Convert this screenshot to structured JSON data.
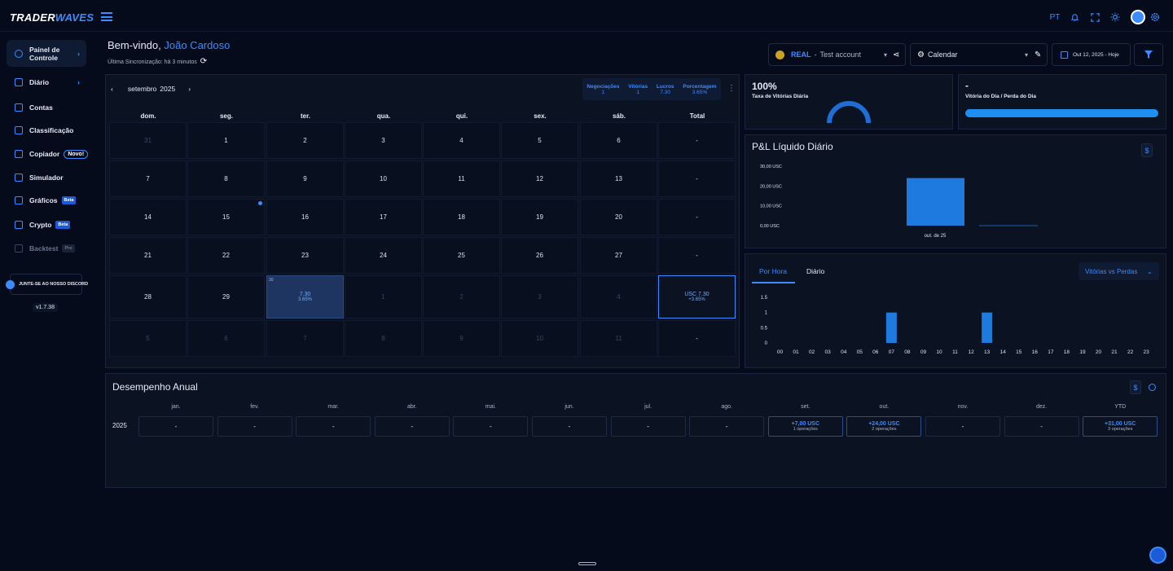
{
  "topbar": {
    "logo_a": "TRADER",
    "logo_b": "WAVES",
    "lang": "PT"
  },
  "sidebar": {
    "items": [
      {
        "label": "Painel de Controle",
        "icon": "dashboard-icon"
      },
      {
        "label": "Diário",
        "icon": "pencil-icon"
      },
      {
        "label": "Contas",
        "icon": "accounts-icon"
      },
      {
        "label": "Classificação",
        "icon": "ranking-icon"
      },
      {
        "label": "Copiador",
        "icon": "copy-icon",
        "badge": "Novo!"
      },
      {
        "label": "Simulador",
        "icon": "simulator-icon"
      },
      {
        "label": "Gráficos",
        "icon": "chart-icon",
        "badge": "Beta"
      },
      {
        "label": "Crypto",
        "icon": "bitcoin-icon",
        "badge": "Beta"
      },
      {
        "label": "Backtest",
        "icon": "rewind-icon",
        "badge": "Pro"
      }
    ],
    "discord": "JUNTE-SE AO NOSSO DISCORD",
    "version": "v1.7.38"
  },
  "header": {
    "welcome": "Bem-vindo,",
    "user": "João Cardoso",
    "sync": "Última Sincronização: há 3 minutos",
    "account_type": "REAL",
    "account_sep": "-",
    "account_name": "Test account",
    "view": "Calendar",
    "date_range": "Out 12, 2025 - Hoje"
  },
  "calendar": {
    "month": "setembro",
    "year": "2025",
    "stats": [
      {
        "label": "Negociações",
        "value": "1"
      },
      {
        "label": "Vitórias",
        "value": "1"
      },
      {
        "label": "Lucros",
        "value": "7.30"
      },
      {
        "label": "Porcentagem",
        "value": "3.65%"
      }
    ],
    "weekdays": [
      "dom.",
      "seg.",
      "ter.",
      "qua.",
      "qui.",
      "sex.",
      "sáb.",
      "Total"
    ],
    "weeks": [
      {
        "days": [
          "31",
          "1",
          "2",
          "3",
          "4",
          "5",
          "6"
        ],
        "total": "-"
      },
      {
        "days": [
          "7",
          "8",
          "9",
          "10",
          "11",
          "12",
          "13"
        ],
        "total": "-"
      },
      {
        "days": [
          "14",
          "15",
          "16",
          "17",
          "18",
          "19",
          "20"
        ],
        "total": "-"
      },
      {
        "days": [
          "21",
          "22",
          "23",
          "24",
          "25",
          "26",
          "27"
        ],
        "total": "-"
      },
      {
        "days": [
          "28",
          "29",
          "30",
          "1",
          "2",
          "3",
          "4"
        ],
        "total": "USC 7.30",
        "total_pct": "+3.65%"
      },
      {
        "days": [
          "5",
          "6",
          "7",
          "8",
          "9",
          "10",
          "11"
        ],
        "total": "-"
      }
    ],
    "selected_day": {
      "label": "30",
      "value": "7.30",
      "pct": "3.65%"
    }
  },
  "kpi": {
    "win_rate": "100%",
    "win_rate_label": "Taxa de Vitórias Diária",
    "win_rate_value": 1.0,
    "win_loss": "-",
    "win_loss_label": "Vitória do Dia / Perda do Dia"
  },
  "pnl": {
    "title": "P&L Líquido Diário",
    "currency_btn": "$"
  },
  "hourly": {
    "tabs": [
      "Por Hora",
      "Diário"
    ],
    "select": "Vitórias vs Perdas"
  },
  "chart_data": [
    {
      "type": "bar",
      "categories": [
        "out. de 25"
      ],
      "values": [
        24
      ],
      "yticks": [
        "30,00 USC",
        "20,00 USC",
        "10,00 USC",
        "0,00 USC"
      ],
      "ylim": [
        0,
        30
      ]
    },
    {
      "type": "bar",
      "categories": [
        "00",
        "01",
        "02",
        "03",
        "04",
        "05",
        "06",
        "07",
        "08",
        "09",
        "10",
        "11",
        "12",
        "13",
        "14",
        "15",
        "16",
        "17",
        "18",
        "19",
        "20",
        "21",
        "22",
        "23"
      ],
      "values": [
        0,
        0,
        0,
        0,
        0,
        0,
        0,
        1,
        0,
        0,
        0,
        0,
        0,
        1,
        0,
        0,
        0,
        0,
        0,
        0,
        0,
        0,
        0,
        0
      ],
      "yticks": [
        "1.5",
        "1",
        "0.5",
        "0"
      ],
      "ylim": [
        0,
        1.5
      ]
    }
  ],
  "annual": {
    "title": "Desempenho Anual",
    "currency_btn": "$",
    "year": "2025",
    "months": [
      "jan.",
      "fev.",
      "mar.",
      "abr.",
      "mai.",
      "jun.",
      "jul.",
      "ago.",
      "set.",
      "out.",
      "nov.",
      "dez.",
      "YTD"
    ],
    "values": [
      {
        "v": "-"
      },
      {
        "v": "-"
      },
      {
        "v": "-"
      },
      {
        "v": "-"
      },
      {
        "v": "-"
      },
      {
        "v": "-"
      },
      {
        "v": "-"
      },
      {
        "v": "-"
      },
      {
        "v": "+7,00 USC",
        "o": "1 operações"
      },
      {
        "v": "+24,00 USC",
        "o": "2 operações"
      },
      {
        "v": "-"
      },
      {
        "v": "-"
      },
      {
        "v": "+31,00 USC",
        "o": "3 operações"
      }
    ]
  }
}
